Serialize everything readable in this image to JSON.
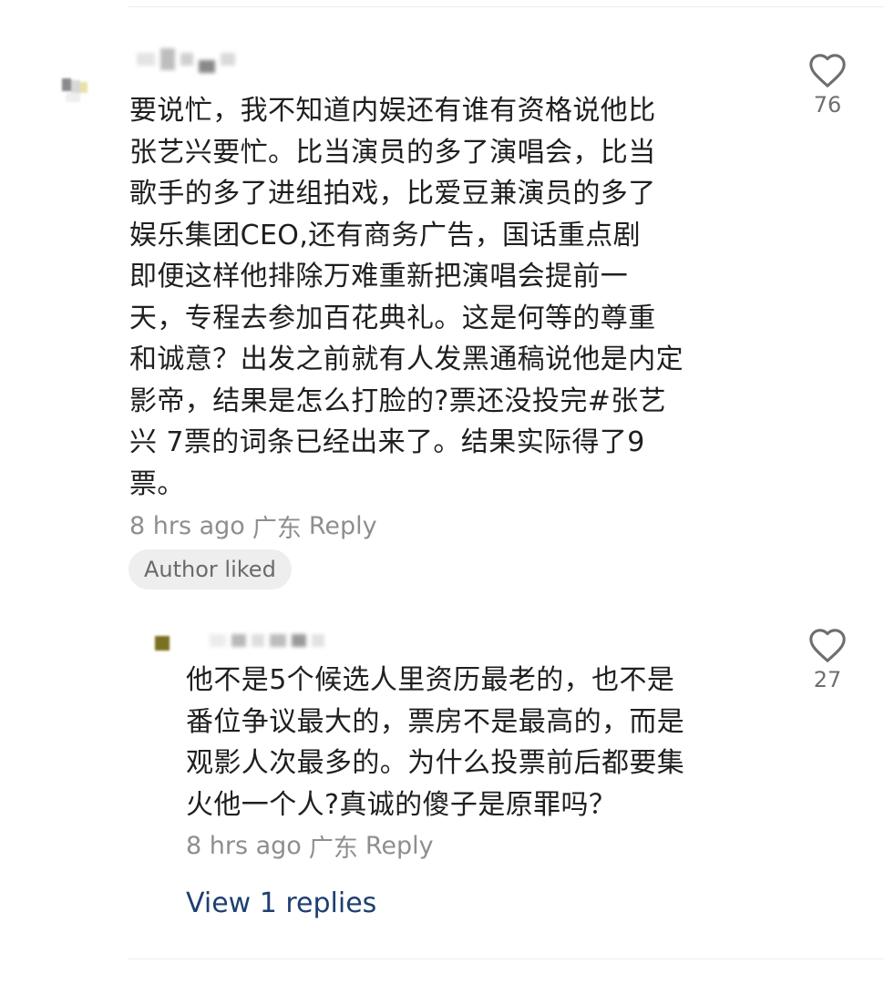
{
  "comments": [
    {
      "text": "要说忙，我不知道内娱还有谁有资格说他比\n张艺兴要忙。比当演员的多了演唱会，比当\n歌手的多了进组拍戏，比爱豆兼演员的多了\n娱乐集团CEO,还有商务广告，国话重点剧\n即便这样他排除万难重新把演唱会提前一\n天，专程去参加百花典礼。这是何等的尊重\n和诚意？出发之前就有人发黑通稿说他是内定\n影帝，结果是怎么打脸的?票还没投完#张艺\n兴 7票的词条已经出来了。结果实际得了9\n票。",
      "time": "8 hrs ago",
      "location": "广东",
      "reply_label": "Reply",
      "badge": "Author liked",
      "likes": "76",
      "like_icon": "heart-outline-icon"
    },
    {
      "text": "他不是5个候选人里资历最老的，也不是\n番位争议最大的，票房不是最高的，而是\n观影人次最多的。为什么投票前后都要集\n火他一个人?真诚的傻子是原罪吗？",
      "time": "8 hrs ago",
      "location": "广东",
      "reply_label": "Reply",
      "likes": "27",
      "like_icon": "heart-outline-icon"
    }
  ],
  "view_replies_label": "View 1 replies",
  "colors": {
    "link": "#1e3f70",
    "meta": "#8e8e8e",
    "badge_bg": "#eeeeee"
  }
}
